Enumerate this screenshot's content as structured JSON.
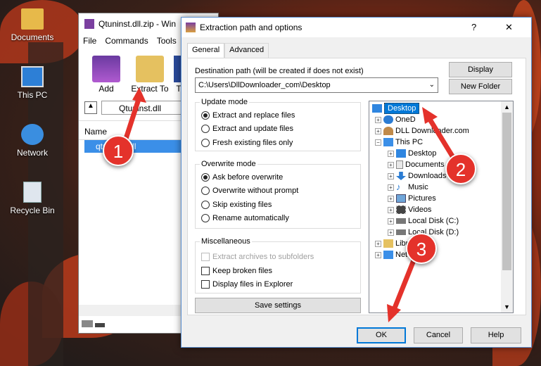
{
  "desktop": {
    "icons": [
      {
        "label": "Documents"
      },
      {
        "label": "This PC"
      },
      {
        "label": "Network"
      },
      {
        "label": "Recycle Bin"
      }
    ]
  },
  "archive_window": {
    "title": "Qtuninst.dll.zip - Win",
    "menu": [
      "File",
      "Commands",
      "Tools"
    ],
    "toolbar": {
      "add": "Add",
      "extract": "Extract To",
      "third": "T"
    },
    "path": "Qtuninst.dll",
    "column_name": "Name",
    "file_row": "qtuninst.dll"
  },
  "dialog": {
    "title": "Extraction path and options",
    "help": "?",
    "close": "✕",
    "tabs": [
      "General",
      "Advanced"
    ],
    "dest_label": "Destination path (will be created if does not exist)",
    "dest_value": "C:\\Users\\DllDownloader_com\\Desktop",
    "display_btn": "Display",
    "new_folder_btn": "New Folder",
    "update_mode": {
      "label": "Update mode",
      "options": [
        "Extract and replace files",
        "Extract and update files",
        "Fresh existing files only"
      ]
    },
    "overwrite_mode": {
      "label": "Overwrite mode",
      "options": [
        "Ask before overwrite",
        "Overwrite without prompt",
        "Skip existing files",
        "Rename automatically"
      ]
    },
    "misc": {
      "label": "Miscellaneous",
      "options": [
        "Extract archives to subfolders",
        "Keep broken files",
        "Display files in Explorer"
      ]
    },
    "save_btn": "Save settings",
    "tree": [
      "Desktop",
      "OneD",
      "DLL Downloader.com",
      "This PC",
      "Desktop",
      "Documents",
      "Downloads",
      "Music",
      "Pictures",
      "Videos",
      "Local Disk (C:)",
      "Local Disk (D:)",
      "Libr",
      "Net"
    ],
    "ok": "OK",
    "cancel": "Cancel",
    "help_btn": "Help"
  },
  "annotations": [
    "1",
    "2",
    "3"
  ],
  "colors": {
    "annotation": "#e4322b",
    "selection": "#0078d7"
  }
}
